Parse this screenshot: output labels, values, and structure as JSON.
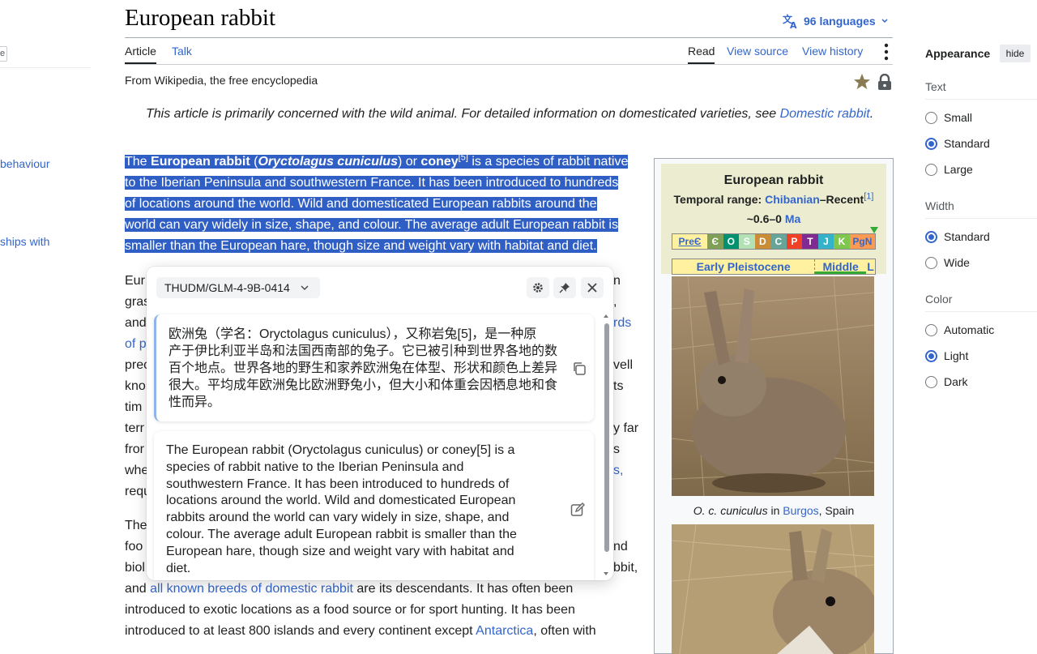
{
  "left_sidebar": {
    "stub_label": "e",
    "links": [
      "behaviour",
      "ships with"
    ]
  },
  "page": {
    "title": "European rabbit",
    "languages": "96 languages",
    "tabs_left": [
      "Article",
      "Talk"
    ],
    "tabs_right": [
      "Read",
      "View source",
      "View history"
    ],
    "tagline": "From Wikipedia, the free encyclopedia"
  },
  "hatnote": {
    "text": "This article is primarily concerned with the wild animal. For detailed information on domesticated varieties, see ",
    "link": "Domestic rabbit",
    "end": "."
  },
  "lead": {
    "line1_a": "The ",
    "line1_b": "European rabbit",
    "line1_c": " (",
    "line1_d": "Oryctolagus cuniculus",
    "line1_e": ") or ",
    "line1_f": "coney",
    "line1_ref": "[5]",
    "line1_g": " is a species of rabbit native",
    "lines": [
      "to the Iberian Peninsula and southwestern France. It has been introduced to hundreds",
      "of locations around the world. Wild and domesticated European rabbits around the",
      "world can vary widely in size, shape, and colour. The average adult European rabbit is",
      "smaller than the European hare, though size and weight vary with habitat and diet."
    ]
  },
  "occluded_para": {
    "left_fragments": [
      "Eur",
      "gras",
      "and",
      "of p",
      "prec",
      "kno",
      "tim",
      "terr",
      "fror",
      "whe",
      "requ"
    ],
    "right_fragments": [
      "n",
      ",",
      "rds",
      "vell",
      "ts",
      "y far",
      "s",
      "s,"
    ]
  },
  "para3": {
    "left_fragments": [
      "The",
      "foo",
      "biol"
    ],
    "right_fragments": [
      "nd",
      "bbit,"
    ],
    "line4_a": "and ",
    "line4_link": "all known breeds of domestic rabbit",
    "line4_b": " are its descendants. It has often been",
    "line5": "introduced to exotic locations as a food source or for sport hunting. It has been",
    "line6_a": "introduced to at least 800 islands and every continent except ",
    "line6_link": "Antarctica",
    "line6_b": ", often with"
  },
  "infobox": {
    "title": "European rabbit",
    "range_label": "Temporal range: ",
    "range_link": "Chibanian",
    "range_end": "–Recent",
    "range_ref": "[1]",
    "ma_value": "~0.6–0 ",
    "ma_unit": "Ma",
    "periods": [
      "PreЄ",
      "Є",
      "O",
      "S",
      "D",
      "C",
      "P",
      "T",
      "J",
      "K",
      "PgN"
    ],
    "period_colors": [
      "#f74370",
      "#7fa056",
      "#009270",
      "#b3e1b6",
      "#cb8c37",
      "#67a599",
      "#f04028",
      "#812b92",
      "#34b2c9",
      "#7fc64e",
      "#fd9a52"
    ],
    "epochs": [
      "Early Pleistocene",
      "Middle",
      "L"
    ],
    "caption_italic": "O. c. cuniculus",
    "caption_mid": " in ",
    "caption_link": "Burgos",
    "caption_end": ", Spain"
  },
  "appearance": {
    "title": "Appearance",
    "hide": "hide",
    "text_label": "Text",
    "text_options": [
      "Small",
      "Standard",
      "Large"
    ],
    "text_selected": "Standard",
    "width_label": "Width",
    "width_options": [
      "Standard",
      "Wide"
    ],
    "width_selected": "Standard",
    "color_label": "Color",
    "color_options": [
      "Automatic",
      "Light",
      "Dark"
    ],
    "color_selected": "Light"
  },
  "popup": {
    "model": "THUDM/GLM-4-9B-0414",
    "translation_lines": [
      "欧洲兔（学名：Oryctolagus cuniculus），又称岩兔[5]，是一种原",
      "产于伊比利亚半岛和法国西南部的兔子。它已被引种到世界各地的数",
      "百个地点。世界各地的野生和家养欧洲兔在体型、形状和颜色上差异",
      "很大。平均成年欧洲兔比欧洲野兔小，但大小和体重会因栖息地和食",
      "性而异。"
    ],
    "source_lines": [
      "The European rabbit (Oryctolagus cuniculus) or coney[5] is a",
      "species of rabbit native to the Iberian Peninsula and",
      "southwestern France. It has been introduced to hundreds of",
      "locations around the world. Wild and domesticated European",
      "rabbits around the world can vary widely in size, shape, and",
      "colour. The average adult European rabbit is smaller than the",
      "European hare, though size and weight vary with habitat and",
      "diet."
    ]
  }
}
